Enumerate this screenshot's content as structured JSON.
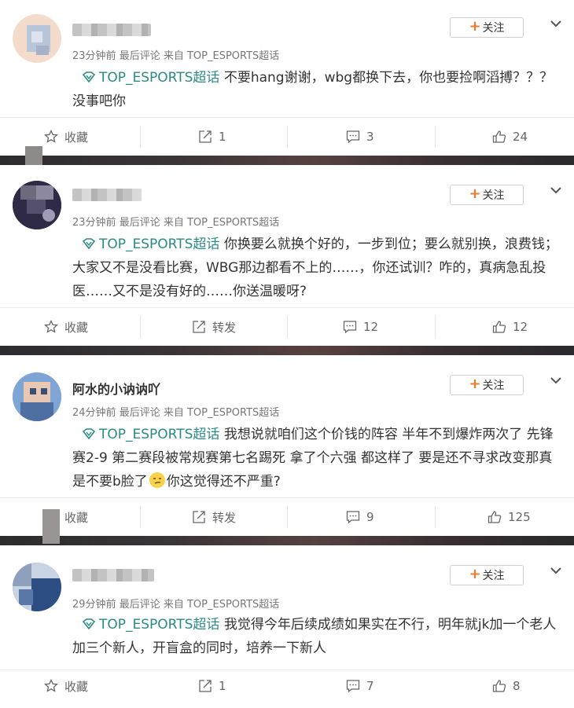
{
  "comments": [
    {
      "username": "",
      "time": "23分钟前",
      "last": "最后评论",
      "source": "来自 TOP_ESPORTS超话",
      "follow": "关注",
      "topic": "TOP_ESPORTS超话",
      "text": "不要hang谢谢，wbg都换下去，你也要捡啊滔搏？？？没事吧你",
      "actions": {
        "fav": "收藏",
        "repost": "1",
        "comment": "3",
        "like": "24"
      }
    },
    {
      "username": "",
      "time": "23分钟前",
      "last": "最后评论",
      "source": "来自 TOP_ESPORTS超话",
      "follow": "关注",
      "topic": "TOP_ESPORTS超话",
      "text": "你换要么就换个好的，一步到位；要么就别换，浪费钱；大家又不是没看比赛，WBG那边都看不上的……，你还试训？咋的，真病急乱投医……又不是没有好的……你送温暖呀?",
      "actions": {
        "fav": "收藏",
        "repost": "转发",
        "comment": "12",
        "like": "12"
      }
    },
    {
      "username": "阿水的小讷讷吖",
      "time": "24分钟前",
      "last": "最后评论",
      "source": "来自 TOP_ESPORTS超话",
      "follow": "关注",
      "topic": "TOP_ESPORTS超话",
      "text": "我想说就咱们这个价钱的阵容 半年不到爆炸两次了 先锋赛2-9 第二赛段被常规赛第七名踢死 拿了个六强 都这样了 要是还不寻求改变那真是不要b脸了",
      "text2": "你这觉得还不严重?",
      "actions": {
        "fav": "收藏",
        "repost": "转发",
        "comment": "9",
        "like": "125"
      }
    },
    {
      "username": "",
      "time": "29分钟前",
      "last": "最后评论",
      "source": "来自 TOP_ESPORTS超话",
      "follow": "关注",
      "topic": "TOP_ESPORTS超话",
      "text": "我觉得今年后续成绩如果实在不行，明年就jk加一个老人加三个新人，开盲盒的同时，培养一下新人",
      "actions": {
        "fav": "收藏",
        "repost": "1",
        "comment": "7",
        "like": "8"
      }
    }
  ],
  "colors": {
    "topic": "#2b8a84",
    "plus": "#f2792b",
    "separator": "#2c2b2e"
  }
}
